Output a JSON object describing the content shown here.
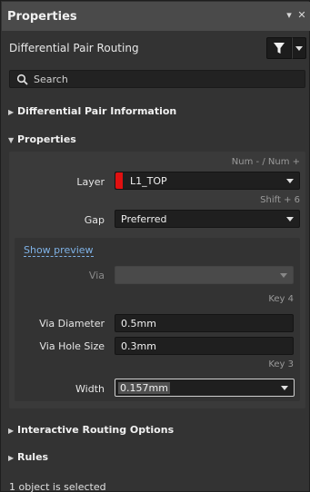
{
  "titlebar": {
    "title": "Properties",
    "pin_glyph": "▾",
    "close_glyph": "✕"
  },
  "header": {
    "context_label": "Differential Pair Routing",
    "filter_icon": "filter-icon"
  },
  "search": {
    "placeholder": "Search"
  },
  "sections": {
    "dp_info": {
      "label": "Differential Pair Information",
      "expanded": false
    },
    "properties": {
      "label": "Properties",
      "expanded": true
    },
    "interactive": {
      "label": "Interactive Routing Options",
      "expanded": false
    },
    "rules": {
      "label": "Rules",
      "expanded": false
    }
  },
  "props": {
    "layer_hint": "Num - / Num +",
    "layer_label": "Layer",
    "layer_value": "L1_TOP",
    "layer_color": "#e01010",
    "gap_hint": "Shift + 6",
    "gap_label": "Gap",
    "gap_value": "Preferred",
    "show_preview": "Show preview",
    "via_label": "Via",
    "via_value": "",
    "via_hint": "Key 4",
    "via_diameter_label": "Via Diameter",
    "via_diameter_value": "0.5mm",
    "via_hole_label": "Via Hole Size",
    "via_hole_value": "0.3mm",
    "width_hint": "Key 3",
    "width_label": "Width",
    "width_value": "0.157mm"
  },
  "footer": {
    "status": "1 object is selected"
  }
}
